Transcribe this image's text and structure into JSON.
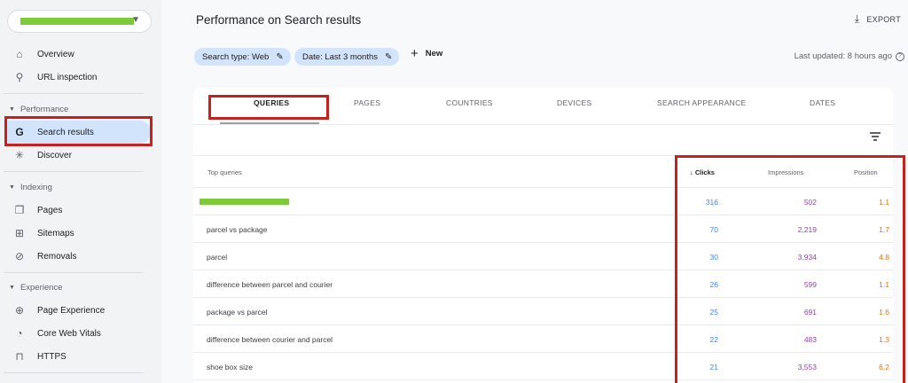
{
  "sidebar": {
    "items": [
      {
        "icon": "home-icon",
        "glyph": "⌂",
        "label": "Overview"
      },
      {
        "icon": "search-icon",
        "glyph": "⚲",
        "label": "URL inspection"
      },
      {
        "icon": "google-g-icon",
        "glyph": "G",
        "label": "Search results"
      },
      {
        "icon": "asterisk-icon",
        "glyph": "✳",
        "label": "Discover"
      },
      {
        "icon": "pages-icon",
        "glyph": "❐",
        "label": "Pages"
      },
      {
        "icon": "sitemap-icon",
        "glyph": "⊞",
        "label": "Sitemaps"
      },
      {
        "icon": "eye-off-icon",
        "glyph": "⊘",
        "label": "Removals"
      },
      {
        "icon": "plus-circle-icon",
        "glyph": "⊕",
        "label": "Page Experience"
      },
      {
        "icon": "gauge-icon",
        "glyph": "◔",
        "label": "Core Web Vitals"
      },
      {
        "icon": "lock-icon",
        "glyph": "⊓",
        "label": "HTTPS"
      }
    ],
    "sections": [
      "Performance",
      "Indexing",
      "Experience"
    ]
  },
  "header": {
    "title": "Performance on Search results",
    "export_label": "EXPORT",
    "last_updated": "Last updated: 8 hours ago"
  },
  "filters": {
    "search_type": "Search type: Web",
    "date": "Date: Last 3 months",
    "new_label": "New"
  },
  "tabs": [
    "QUERIES",
    "PAGES",
    "COUNTRIES",
    "DEVICES",
    "SEARCH APPEARANCE",
    "DATES"
  ],
  "table": {
    "headers": {
      "query": "Top queries",
      "clicks": "Clicks",
      "impressions": "Impressions",
      "position": "Position"
    },
    "rows": [
      {
        "query": "",
        "clicks": "316",
        "impressions": "502",
        "position": "1.1"
      },
      {
        "query": "parcel vs package",
        "clicks": "70",
        "impressions": "2,219",
        "position": "1.7"
      },
      {
        "query": "parcel",
        "clicks": "30",
        "impressions": "3,934",
        "position": "4.8"
      },
      {
        "query": "difference between parcel and courier",
        "clicks": "26",
        "impressions": "599",
        "position": "1.1"
      },
      {
        "query": "package vs parcel",
        "clicks": "25",
        "impressions": "691",
        "position": "1.6"
      },
      {
        "query": "difference between courier and parcel",
        "clicks": "22",
        "impressions": "483",
        "position": "1.3"
      },
      {
        "query": "shoe box size",
        "clicks": "21",
        "impressions": "3,553",
        "position": "6.2"
      }
    ]
  },
  "colors": {
    "clicks": "#4285f4",
    "impressions": "#8e44ad",
    "position": "#e37400",
    "highlight": "#c5221f",
    "redacted": "#7ecb3a"
  }
}
